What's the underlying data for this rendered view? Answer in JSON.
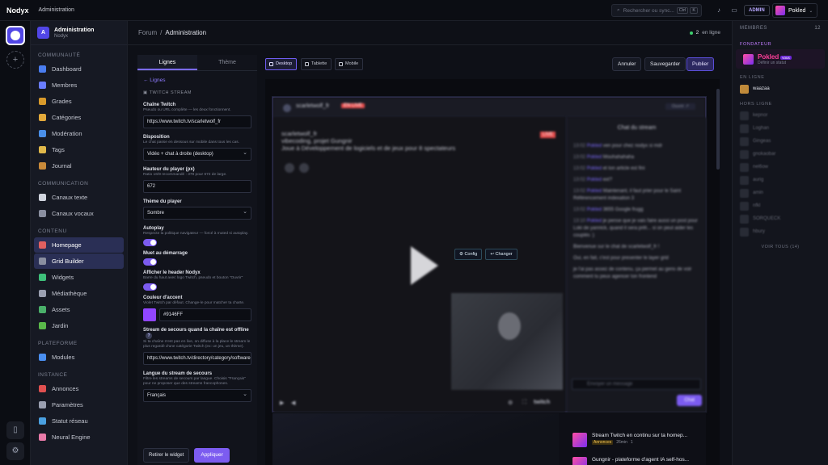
{
  "topbar": {
    "brand": "Nodyx",
    "section": "Administration",
    "search_placeholder": "Rechercher ou sync...",
    "search_kbd": [
      "Ctrl",
      "K"
    ],
    "admin_badge": "ADMIN",
    "username": "Pokled"
  },
  "nav": {
    "header_title": "Administration",
    "header_sub": "Nodyx",
    "header_logo": "A",
    "sections": [
      {
        "title": "COMMUNAUTÉ",
        "items": [
          {
            "label": "Dashboard",
            "icon": "dashboard-icon",
            "color": "#4a7df0"
          },
          {
            "label": "Membres",
            "icon": "members-icon",
            "color": "#6a7dff"
          },
          {
            "label": "Grades",
            "icon": "medal-icon",
            "color": "#d99a2b"
          },
          {
            "label": "Catégories",
            "icon": "folder-icon",
            "color": "#e3a93b"
          },
          {
            "label": "Modération",
            "icon": "shield-icon",
            "color": "#4a8fe8"
          },
          {
            "label": "Tags",
            "icon": "tag-icon",
            "color": "#e0b84a"
          },
          {
            "label": "Journal",
            "icon": "journal-icon",
            "color": "#c98a3a"
          }
        ]
      },
      {
        "title": "COMMUNICATION",
        "items": [
          {
            "label": "Canaux texte",
            "icon": "chat-bubble-icon",
            "color": "#d0d4de"
          },
          {
            "label": "Canaux vocaux",
            "icon": "speaker-icon",
            "color": "#8a8fa0"
          }
        ]
      },
      {
        "title": "CONTENU",
        "items": [
          {
            "label": "Homepage",
            "icon": "home-icon",
            "color": "#e06060",
            "active": true
          },
          {
            "label": "Grid Builder",
            "icon": "grid-icon",
            "color": "#8a8fa0",
            "active": true
          },
          {
            "label": "Widgets",
            "icon": "puzzle-icon",
            "color": "#3ec07a"
          },
          {
            "label": "Médiathèque",
            "icon": "media-icon",
            "color": "#9a9fb0"
          },
          {
            "label": "Assets",
            "icon": "image-icon",
            "color": "#4ab06a"
          },
          {
            "label": "Jardin",
            "icon": "plant-icon",
            "color": "#5ab84a"
          }
        ]
      },
      {
        "title": "PLATEFORME",
        "items": [
          {
            "label": "Modules",
            "icon": "module-icon",
            "color": "#4a8ff0"
          }
        ]
      },
      {
        "title": "INSTANCE",
        "items": [
          {
            "label": "Annonces",
            "icon": "megaphone-icon",
            "color": "#e05050"
          },
          {
            "label": "Paramètres",
            "icon": "gear-icon",
            "color": "#9a9fb0"
          },
          {
            "label": "Statut réseau",
            "icon": "globe-icon",
            "color": "#4aa0e0"
          },
          {
            "label": "Neural Engine",
            "icon": "brain-icon",
            "color": "#e87aa8"
          }
        ]
      }
    ]
  },
  "breadcrumb": {
    "root": "Forum",
    "sep": "/",
    "current": "Administration"
  },
  "online": {
    "count": "2",
    "label": "en ligne"
  },
  "editor": {
    "tabs": [
      "Lignes",
      "Thème"
    ],
    "back": "← Lignes",
    "section_title": "TWITCH STREAM",
    "fields": {
      "channel_label": "Chaîne Twitch",
      "channel_help": "Pseudo ou URL complète — les deux fonctionnent.",
      "channel_value": "https://www.twitch.tv/scarletwolf_fr",
      "layout_label": "Disposition",
      "layout_help": "Le chat passe en dessous sur mobile dans tous les cas.",
      "layout_value": "Vidéo + chat à droite (desktop)",
      "height_label": "Hauteur du player (px)",
      "height_help": "Ratio 16/9 recommandé : 378 pour 672 de large.",
      "height_value": "672",
      "theme_label": "Thème du player",
      "theme_value": "Sombre",
      "autoplay_label": "Autoplay",
      "autoplay_help": "Respecte la politique navigateur — forcé à muted si autoplay.",
      "muted_label": "Muet au démarrage",
      "header_label": "Afficher le header Nodyx",
      "header_help": "Barre du haut avec logo Twitch, pseudo et bouton \"Ouvrir\"",
      "accent_label": "Couleur d'accent",
      "accent_help": "Violet Twitch par défaut. Change-le pour matcher ta charte.",
      "accent_value": "#9146FF",
      "fallback_label": "Stream de secours quand la chaîne est offline",
      "fallback_help": "Si ta chaîne n'est pas en live, on diffuse à la place le stream le plus regardé d'une catégorie Twitch (ex: un jeu, un thème).",
      "fallback_value": "https://www.twitch.tv/directory/category/software",
      "lang_label": "Langue du stream de secours",
      "lang_help": "Filtre les streams de secours par langue. Choisis \"Français\" pour ne proposer que des streams francophones.",
      "lang_value": "Français"
    },
    "remove_button": "Retirer le widget",
    "apply_button": "Appliquer"
  },
  "preview": {
    "devices": [
      "Desktop",
      "Tablette",
      "Mobile"
    ],
    "cancel": "Annuler",
    "save": "Sauvegarder",
    "publish": "Publier",
    "config_button": "⚙ Config",
    "change_button": "↩ Changer",
    "stream": {
      "channel": "scarletwolf_fr",
      "live_badge": "EN LIVE",
      "live_tag": "LIVE",
      "title_line1": "scarletwolf_fr",
      "title_line2": "vibecoding, projet Gungnir",
      "title_line3": "Joue à Développement de logiciels et de jeux pour 8 spectateurs",
      "open_button": "Ouvrir ↗",
      "chat_title": "Chat du stream",
      "chat_messages": [
        {
          "time": "13:02",
          "user": "Pokled",
          "text": "ven pour chez nodyx si mdr"
        },
        {
          "time": "13:02",
          "user": "Pokled",
          "text": "Mouhahahaha"
        },
        {
          "time": "13:02",
          "user": "Pokled",
          "text": "et ton article est fini"
        },
        {
          "time": "13:02",
          "user": "Pokled",
          "text": "ext?"
        },
        {
          "time": "13:02",
          "user": "Pokled",
          "text": "Maintenant, il faut prier pour le Saint Référencement indexation 3"
        },
        {
          "time": "13:02",
          "user": "Pokled",
          "text": "3655 Google frugg"
        },
        {
          "time": "13:10",
          "user": "Pokled",
          "text": "je pense que je vais faire aussi un post pour Loki de yannick, quand il sera prêt... si on peut aider les couplés :)"
        }
      ],
      "welcome": "Bienvenue sur le chat de scarletwolf_fr !",
      "reply": "Oui, en fait, c'est pour presenter le layer grid",
      "reply2": "je l'ai pas assez de contenu, ça permet au gens de voir comment tu peux agencer ton frontend",
      "chat_placeholder": "Envoyer un message",
      "send": "Chat",
      "watermark": "twitch"
    },
    "news": [
      {
        "title": "Stream Twitch en continu sur ta homep...",
        "tag": "Annonces",
        "time": "26min",
        "replies": "1"
      },
      {
        "title": "Gungnir - plateforme d'agent IA self-hos...",
        "tag": "",
        "time": "",
        "replies": ""
      }
    ]
  },
  "members": {
    "title": "MEMBRES",
    "count": "12",
    "founder_section": "FONDATEUR",
    "founder_name": "Pokled",
    "founder_tag": "vous",
    "founder_status": "Définir un statut",
    "online_section": "EN LIGNE",
    "online_members": [
      "waazaa"
    ],
    "offline_section": "HORS LIGNE",
    "offline_members": [
      "kepnor",
      "Loghan",
      "Gingeas",
      "gnokaobar",
      "nel6ow",
      "aurig",
      "amin",
      "nfkl",
      "SORQUECK",
      "hbury"
    ],
    "see_all": "VOIR TOUS (14)"
  }
}
